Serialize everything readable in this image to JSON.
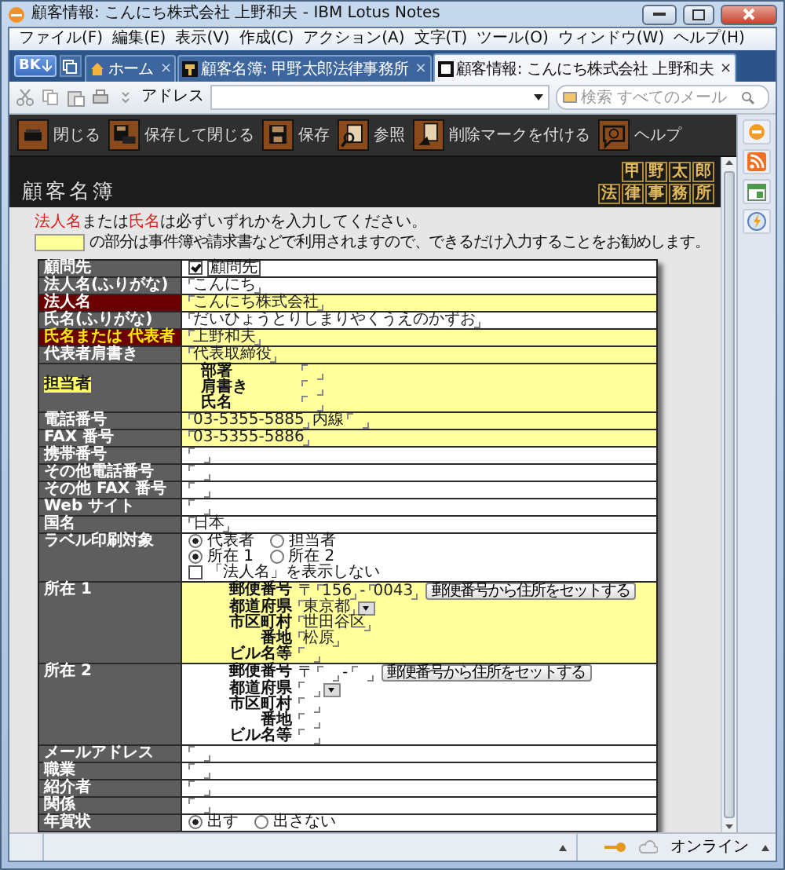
{
  "window": {
    "title": "顧客情報: こんにち株式会社 上野和夫 - IBM Lotus Notes"
  },
  "menu": [
    "ファイル(F)",
    "編集(E)",
    "表示(V)",
    "作成(C)",
    "アクション(A)",
    "文字(T)",
    "ツール(O)",
    "ウィンドウ(W)",
    "ヘルプ(H)"
  ],
  "bookmark_button": "BK",
  "tabs": [
    {
      "label": "ホーム",
      "kind": "home",
      "selected": false,
      "close": "×"
    },
    {
      "label": "顧客名簿: 甲野太郎法律事務所",
      "kind": "database",
      "selected": false,
      "close": "×"
    },
    {
      "label": "顧客情報: こんにち株式会社 上野和夫",
      "kind": "document",
      "selected": true,
      "close": "×"
    }
  ],
  "toolbar": {
    "address_label": "アドレス",
    "search": {
      "placeholder": "検索 すべてのメール"
    }
  },
  "actions": [
    {
      "label": "閉じる",
      "kind": "close"
    },
    {
      "label": "保存して閉じる",
      "kind": "save_close"
    },
    {
      "label": "保存",
      "kind": "save"
    },
    {
      "label": "参照",
      "kind": "browse"
    },
    {
      "label": "削除マークを付ける",
      "kind": "delete"
    },
    {
      "label": "ヘルプ",
      "kind": "help"
    }
  ],
  "header": {
    "title": "顧客名簿",
    "logo": [
      "甲野太郎",
      "法律事務所"
    ]
  },
  "notice": {
    "parts": [
      {
        "text": "法人名",
        "required": true
      },
      {
        "text": "または",
        "required": false
      },
      {
        "text": "氏名",
        "required": true
      },
      {
        "text": "は必ずいずれかを入力してください。",
        "required": false
      }
    ],
    "highlight_note": "の部分は事件簿や請求書などで利用されますので、できるだけ入力することをお勧めします。"
  },
  "form": [
    {
      "label": "顧問先",
      "required": false,
      "marked": false,
      "kind": "checkbox",
      "text": "顧問先",
      "checked": true,
      "highlighted": false
    },
    {
      "label": "法人名(ふりがな)",
      "required": false,
      "marked": false,
      "kind": "text",
      "value": "こんにち",
      "highlighted": false
    },
    {
      "label": "法人名",
      "required": true,
      "marked": false,
      "kind": "text",
      "value": "こんにち株式会社",
      "highlighted": true
    },
    {
      "label": "氏名(ふりがな)",
      "required": false,
      "marked": false,
      "kind": "text",
      "value": "だいひょうとりしまりやくうえのかずお",
      "highlighted": false
    },
    {
      "label": "氏名または 代表者",
      "required": true,
      "marked": true,
      "kind": "text",
      "value": "上野和夫",
      "highlighted": true
    },
    {
      "label": "代表者肩書き",
      "required": false,
      "marked": false,
      "kind": "text",
      "value": "代表取締役",
      "highlighted": true
    },
    {
      "label": "担当者",
      "required": false,
      "marked": true,
      "kind": "subfields",
      "highlighted": true,
      "fields": [
        {
          "label": "部署"
        },
        {
          "label": "肩書き"
        },
        {
          "label": "氏名"
        }
      ]
    },
    {
      "label": "電話番号",
      "required": false,
      "marked": false,
      "kind": "phone",
      "value": "03-5355-5885",
      "extension_label": "内線",
      "highlighted": true
    },
    {
      "label": "FAX 番号",
      "required": false,
      "marked": false,
      "kind": "text",
      "value": "03-5355-5886",
      "highlighted": true
    },
    {
      "label": "携帯番号",
      "required": false,
      "marked": false,
      "kind": "text",
      "highlighted": false
    },
    {
      "label": "その他電話番号",
      "required": false,
      "marked": false,
      "kind": "text",
      "highlighted": false
    },
    {
      "label": "その他 FAX 番号",
      "required": false,
      "marked": false,
      "kind": "text",
      "highlighted": false
    },
    {
      "label": "Web サイト",
      "required": false,
      "marked": false,
      "kind": "text",
      "highlighted": false
    },
    {
      "label": "国名",
      "required": false,
      "marked": false,
      "kind": "text",
      "value": "日本",
      "highlighted": false
    },
    {
      "label": "ラベル印刷対象",
      "required": false,
      "marked": false,
      "kind": "options",
      "highlighted": false,
      "groups": [
        {
          "kind": "radio",
          "options": [
            {
              "label": "代表者",
              "selected": true
            },
            {
              "label": "担当者",
              "selected": false
            }
          ]
        },
        {
          "kind": "radio",
          "options": [
            {
              "label": "所在 1",
              "selected": true
            },
            {
              "label": "所在 2",
              "selected": false
            }
          ]
        },
        {
          "kind": "checkbox",
          "label": "「法人名」を表示しない",
          "checked": false
        }
      ]
    },
    {
      "label": "所在 1",
      "required": false,
      "marked": false,
      "kind": "address",
      "highlighted": true,
      "postal_label": "郵便番号",
      "postal_mark": "〒",
      "postal": [
        "156",
        "0043"
      ],
      "separator": "-",
      "button": "郵便番号から住所をセットする",
      "fields": [
        {
          "label": "都道府県",
          "value": "東京都",
          "dropdown": true
        },
        {
          "label": "市区町村",
          "value": "世田谷区",
          "dropdown": false
        },
        {
          "label": "番地",
          "value": "松原",
          "dropdown": false
        },
        {
          "label": "ビル名等",
          "dropdown": false
        }
      ]
    },
    {
      "label": "所在 2",
      "required": false,
      "marked": false,
      "kind": "address",
      "highlighted": false,
      "postal_label": "郵便番号",
      "postal_mark": "〒",
      "separator": "-",
      "button": "郵便番号から住所をセットする",
      "fields": [
        {
          "label": "都道府県",
          "dropdown": true
        },
        {
          "label": "市区町村",
          "dropdown": false
        },
        {
          "label": "番地",
          "dropdown": false
        },
        {
          "label": "ビル名等",
          "dropdown": false
        }
      ]
    },
    {
      "label": "メールアドレス",
      "required": false,
      "marked": false,
      "kind": "text",
      "highlighted": false
    },
    {
      "label": "職業",
      "required": false,
      "marked": false,
      "kind": "text",
      "highlighted": false
    },
    {
      "label": "紹介者",
      "required": false,
      "marked": false,
      "kind": "text",
      "highlighted": false
    },
    {
      "label": "関係",
      "required": false,
      "marked": false,
      "kind": "text",
      "highlighted": false
    },
    {
      "label": "年賀状",
      "required": false,
      "marked": false,
      "kind": "options",
      "highlighted": false,
      "groups": [
        {
          "kind": "radio",
          "options": [
            {
              "label": "出す",
              "selected": true
            },
            {
              "label": "出さない",
              "selected": false
            }
          ]
        }
      ]
    }
  ],
  "status_bar": {
    "status": "オンライン"
  }
}
